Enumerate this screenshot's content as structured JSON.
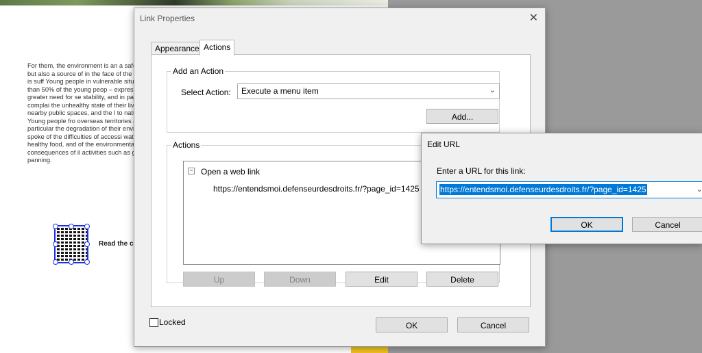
{
  "background_document": {
    "paragraph": "For them, the environment is an a safeguarded, but also a source of in the face of the damage it is suff Young people in vulnerable situati more than 50% of the young peop – expressed a greater need for se stability, and in particular complai the unhealthy state of their living or nearby public spaces, and the l to natural areas. Young people fro overseas territories are particular the degradation of their environm spoke of the difficulties of accessi water and healthy food, and of the environmental consequences of il activities such as gold panning.",
    "qr_caption": "Read the c"
  },
  "link_properties": {
    "title": "Link Properties",
    "close_glyph": "✕",
    "tabs": [
      {
        "label": "Appearance",
        "selected": false
      },
      {
        "label": "Actions",
        "selected": true
      }
    ],
    "add_action": {
      "group_title": "Add an Action",
      "select_label": "Select Action:",
      "selected_action": "Execute a menu item",
      "add_button": "Add..."
    },
    "actions": {
      "group_title": "Actions",
      "tree": {
        "toggle": "−",
        "parent": "Open a web link",
        "child": "https://entendsmoi.defenseurdesdroits.fr/?page_id=1425"
      },
      "buttons": {
        "up": "Up",
        "down": "Down",
        "edit": "Edit",
        "delete": "Delete"
      }
    },
    "locked_label": "Locked",
    "locked_checked": false,
    "ok": "OK",
    "cancel": "Cancel"
  },
  "edit_url": {
    "title": "Edit URL",
    "prompt": "Enter a URL for this link:",
    "url_value": "https://entendsmoi.defenseurdesdroits.fr/?page_id=1425",
    "ok": "OK",
    "cancel": "Cancel"
  },
  "icons": {
    "dropdown": "chevron-down-icon",
    "close": "close-icon",
    "collapse": "collapse-icon"
  }
}
